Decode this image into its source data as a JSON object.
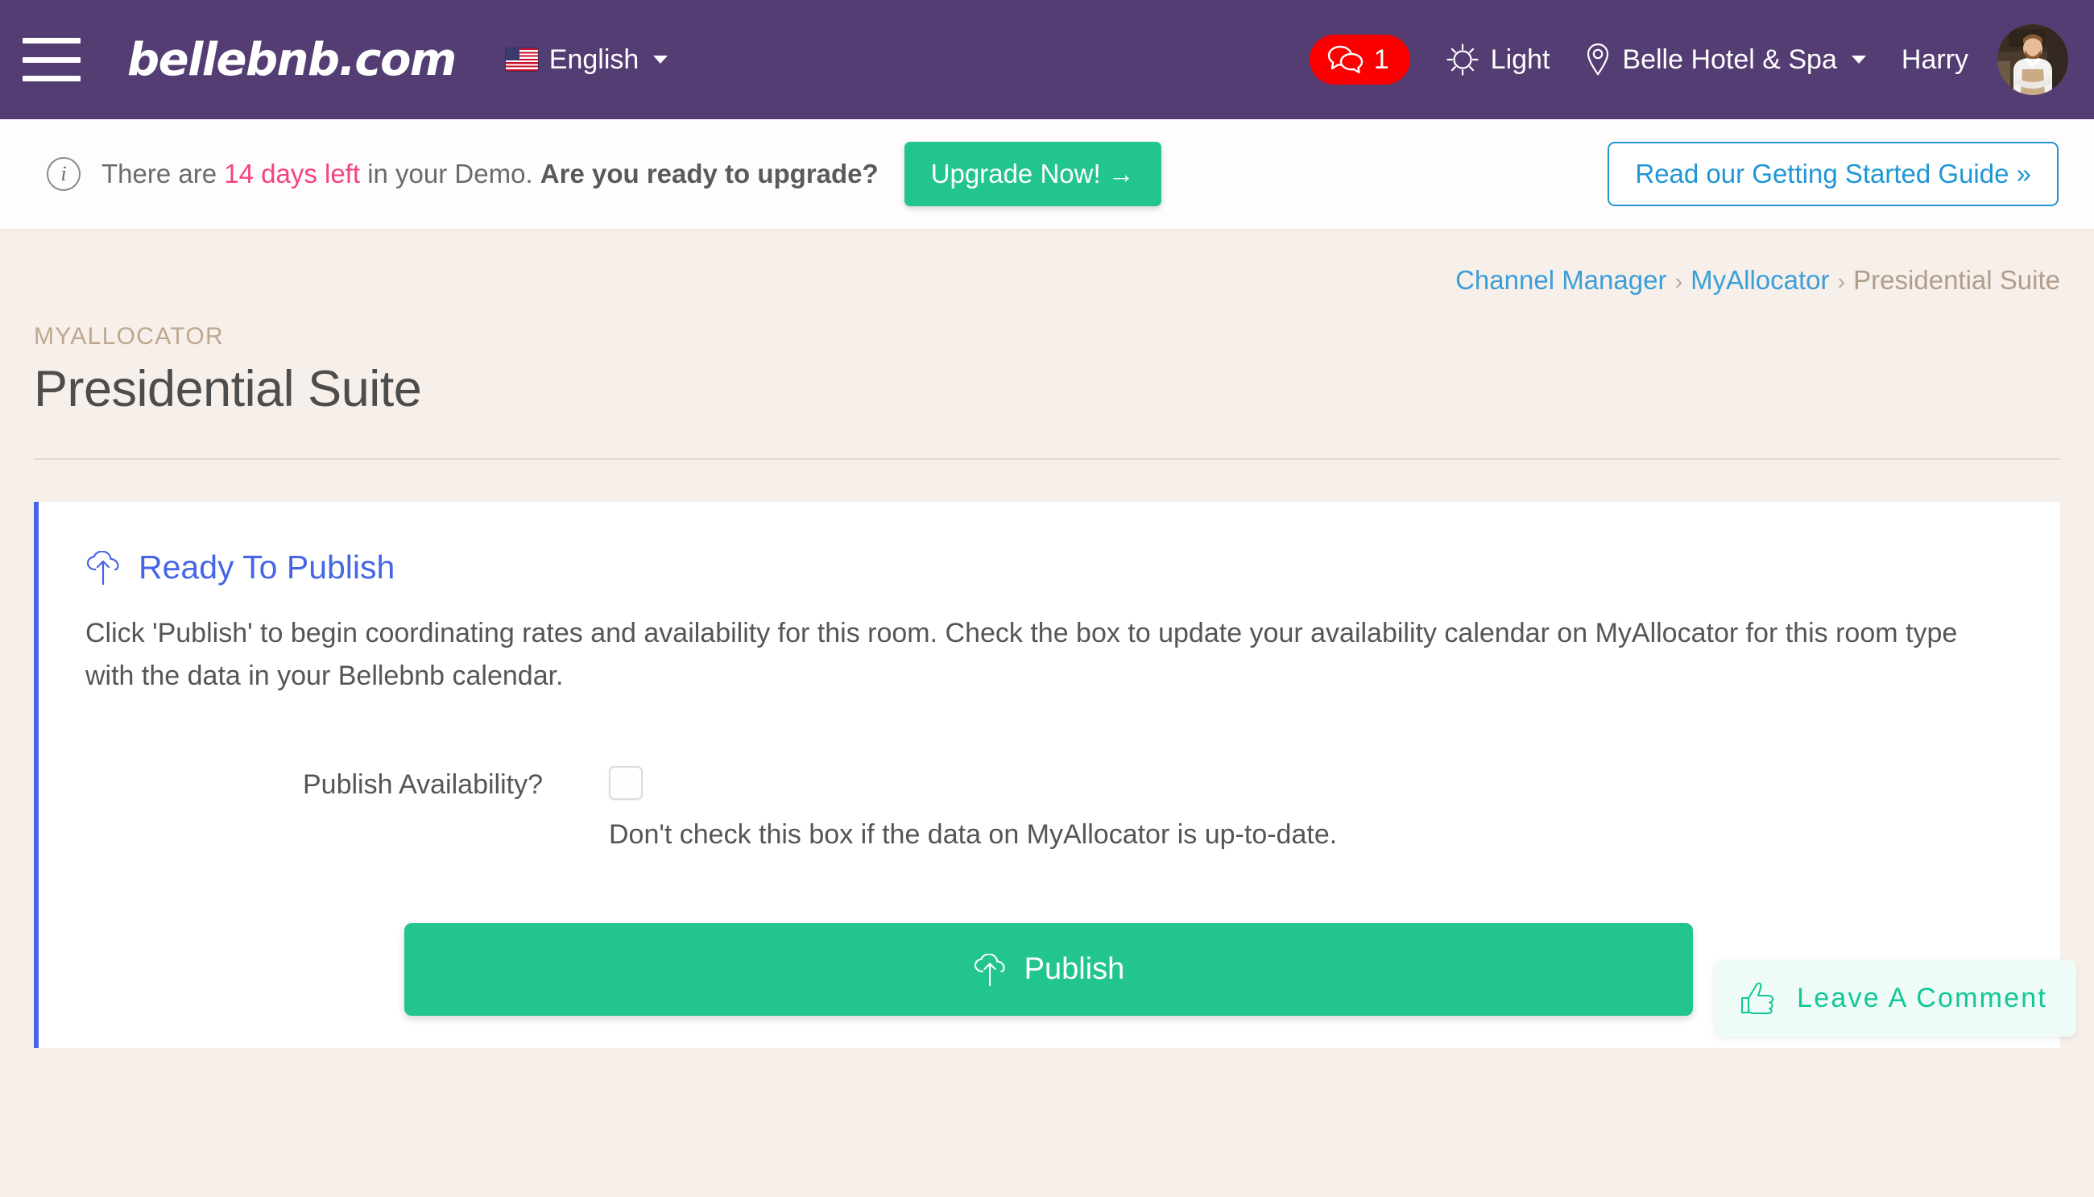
{
  "colors": {
    "nav_bg": "#543d73",
    "page_bg": "#f7efe9",
    "accent_green": "#22c58b",
    "accent_blue": "#4666e5",
    "link_blue": "#3a9fd8",
    "notif_red": "#fa0000",
    "pink": "#f4437f",
    "comment_teal": "#11c79a"
  },
  "topnav": {
    "menu_icon": "hamburger-menu-icon",
    "brand": "bellebnb.com",
    "language": {
      "flag_icon": "us-flag-icon",
      "label": "English",
      "caret_icon": "chevron-down-icon"
    },
    "notifications": {
      "icon": "chat-bubbles-icon",
      "count": "1"
    },
    "theme": {
      "icon": "sun-icon",
      "label": "Light"
    },
    "property": {
      "icon": "map-pin-icon",
      "label": "Belle Hotel & Spa",
      "caret_icon": "chevron-down-icon"
    },
    "user": {
      "name": "Harry",
      "avatar_icon": "user-avatar-photo"
    }
  },
  "demo_banner": {
    "info_icon": "info-circle-icon",
    "text_before": "There are ",
    "days_left": "14 days left",
    "text_middle": " in your Demo. ",
    "question": "Are you ready to upgrade?",
    "upgrade_button": "Upgrade Now! →",
    "guide_button": "Read our Getting Started Guide »"
  },
  "breadcrumb": {
    "items": [
      {
        "label": "Channel Manager",
        "current": false
      },
      {
        "label": "MyAllocator",
        "current": false
      },
      {
        "label": "Presidential Suite",
        "current": true
      }
    ],
    "separator": "›"
  },
  "page_header": {
    "eyebrow": "MYALLOCATOR",
    "title": "Presidential Suite"
  },
  "card": {
    "icon": "cloud-upload-icon",
    "title": "Ready To Publish",
    "description": "Click 'Publish' to begin coordinating rates and availability for this room. Check the box to update your availability calendar on MyAllocator for this room type with the data in your Bellebnb calendar.",
    "form": {
      "label": "Publish Availability?",
      "checkbox_checked": false,
      "help_text": "Don't check this box if the data on MyAllocator is up-to-date."
    },
    "publish_button": {
      "icon": "cloud-upload-icon",
      "label": "Publish"
    }
  },
  "comment_widget": {
    "icon": "thumbs-up-icon",
    "label": "Leave A Comment"
  }
}
